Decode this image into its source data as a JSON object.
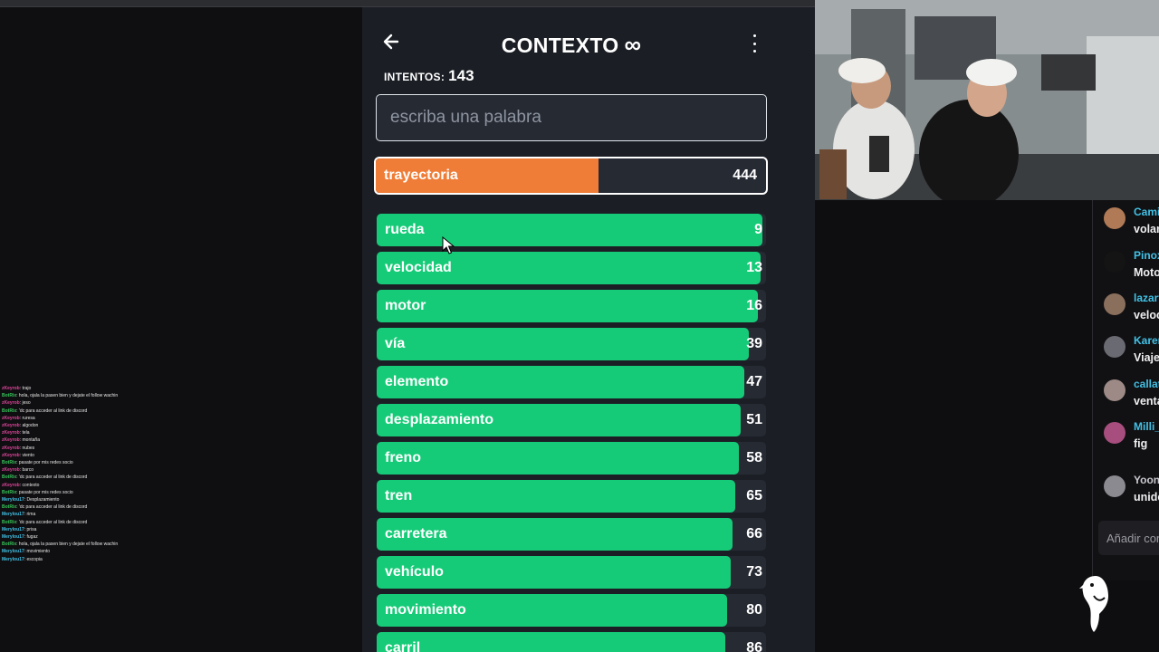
{
  "game": {
    "title": "CONTEXTO",
    "title_symbol": "∞",
    "attempts_label": "INTENTOS:",
    "attempts_value": "143",
    "input_placeholder": "escriba una palabra",
    "current_guess": {
      "word": "trayectoria",
      "rank": "444",
      "fill_fraction": 0.57
    },
    "guesses": [
      {
        "word": "rueda",
        "rank": "9",
        "fill_fraction": 0.99
      },
      {
        "word": "velocidad",
        "rank": "13",
        "fill_fraction": 0.985
      },
      {
        "word": "motor",
        "rank": "16",
        "fill_fraction": 0.98
      },
      {
        "word": "vía",
        "rank": "39",
        "fill_fraction": 0.955
      },
      {
        "word": "elemento",
        "rank": "47",
        "fill_fraction": 0.945
      },
      {
        "word": "desplazamiento",
        "rank": "51",
        "fill_fraction": 0.935
      },
      {
        "word": "freno",
        "rank": "58",
        "fill_fraction": 0.93
      },
      {
        "word": "tren",
        "rank": "65",
        "fill_fraction": 0.92
      },
      {
        "word": "carretera",
        "rank": "66",
        "fill_fraction": 0.915
      },
      {
        "word": "vehículo",
        "rank": "73",
        "fill_fraction": 0.91
      },
      {
        "word": "movimiento",
        "rank": "80",
        "fill_fraction": 0.9
      },
      {
        "word": "carril",
        "rank": "86",
        "fill_fraction": 0.895
      }
    ],
    "colors": {
      "current_fill": "#ef7d38",
      "guess_fill": "#16cb78",
      "background": "#1b1f25"
    }
  },
  "stream_chat": {
    "lines": [
      {
        "user": "zKeyrob",
        "text": ": trajo",
        "color": "#e0449b"
      },
      {
        "user": "BotRix",
        "text": ": hola, ojala la pasen bien y dejate el follow wachin",
        "color": "#35c759"
      },
      {
        "user": "zKeyrob",
        "text": ": jeso",
        "color": "#e0449b"
      },
      {
        "user": "BotRix",
        "text": ": 'dc para acceder al link de discord",
        "color": "#35c759"
      },
      {
        "user": "zKeyrob",
        "text": ": ruresa",
        "color": "#e0449b"
      },
      {
        "user": "zKeyrob",
        "text": ": algodon",
        "color": "#e0449b"
      },
      {
        "user": "zKeyrob",
        "text": ": tela",
        "color": "#e0449b"
      },
      {
        "user": "zKeyrob",
        "text": ": montaña",
        "color": "#e0449b"
      },
      {
        "user": "zKeyrob",
        "text": ": nubes",
        "color": "#e0449b"
      },
      {
        "user": "zKeyrob",
        "text": ": viento",
        "color": "#e0449b"
      },
      {
        "user": "BotRix",
        "text": ": pasate por mis redes socio",
        "color": "#35c759"
      },
      {
        "user": "zKeyrob",
        "text": ": barco",
        "color": "#e0449b"
      },
      {
        "user": "BotRix",
        "text": ": 'dc para acceder al link de discord",
        "color": "#35c759"
      },
      {
        "user": "zKeyrob",
        "text": ": contexto",
        "color": "#e0449b"
      },
      {
        "user": "BotRix",
        "text": ": pasate por mis redes socio",
        "color": "#35c759"
      },
      {
        "user": "Merylou17",
        "text": ": Desplazamiento",
        "color": "#41c1e6"
      },
      {
        "user": "BotRix",
        "text": ": 'dc para acceder al link de discord",
        "color": "#35c759"
      },
      {
        "user": "Merylou17",
        "text": ": rima",
        "color": "#41c1e6"
      },
      {
        "user": "BotRix",
        "text": ": 'dc para acceder al link de discord",
        "color": "#35c759"
      },
      {
        "user": "Merylou17",
        "text": ": prisa",
        "color": "#41c1e6"
      },
      {
        "user": "Merylou17",
        "text": ": fugaz",
        "color": "#41c1e6"
      },
      {
        "user": "BotRix",
        "text": ": hola, ojala la pasen bien y dejate el follow wachin",
        "color": "#35c759"
      },
      {
        "user": "Merylou17",
        "text": ": movimiento",
        "color": "#41c1e6"
      },
      {
        "user": "Merylou17",
        "text": ": escopia",
        "color": "#41c1e6"
      }
    ]
  },
  "side_chat": {
    "messages": [
      {
        "user": "Cami",
        "text": "volan",
        "color": "#41c1e6",
        "avatar_color": "#b07a56"
      },
      {
        "user": "Pinox",
        "text": "Moto",
        "color": "#41c1e6",
        "avatar_color": "#141414"
      },
      {
        "user": "lazart",
        "text": "veloc",
        "color": "#41c1e6",
        "avatar_color": "#8a6f5d"
      },
      {
        "user": "Karen",
        "text": "Viaje",
        "color": "#41c1e6",
        "avatar_color": "#6a6a72"
      },
      {
        "user": "callat",
        "text": "venta",
        "color": "#41c1e6",
        "avatar_color": "#9d8a86"
      },
      {
        "user": "Milli_l",
        "text": "fig",
        "color": "#41c1e6",
        "avatar_color": "#a74e7e"
      },
      {
        "user": "Yoon",
        "text": "unide",
        "color": "#c9c9cf",
        "avatar_color": "#8a8a90"
      }
    ],
    "input_placeholder": "Añadir cor"
  }
}
